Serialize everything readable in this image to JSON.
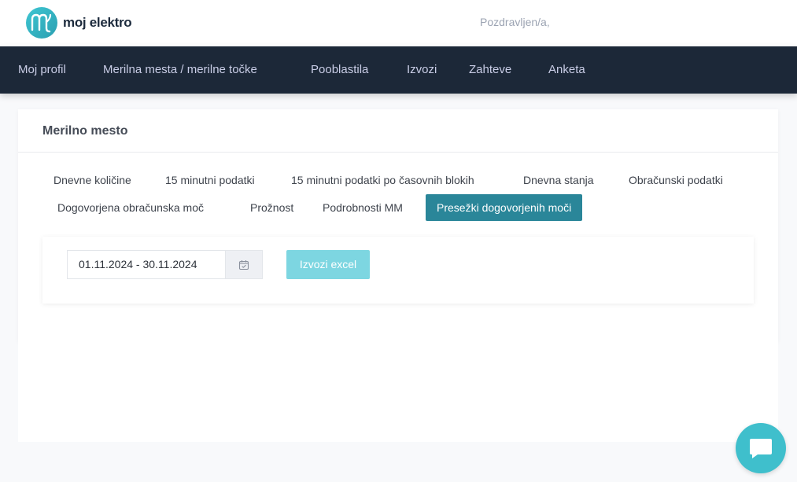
{
  "header": {
    "logo_text": "moj elektro",
    "greeting": "Pozdravljen/a,"
  },
  "nav": {
    "items": [
      {
        "label": "Moj profil"
      },
      {
        "label": "Merilna mesta / merilne točke"
      },
      {
        "label": "Pooblastila"
      },
      {
        "label": "Izvozi"
      },
      {
        "label": "Zahteve"
      },
      {
        "label": "Anketa"
      }
    ]
  },
  "card": {
    "title": "Merilno mesto",
    "tabs": [
      {
        "label": "Dnevne količine"
      },
      {
        "label": "15 minutni podatki"
      },
      {
        "label": "15 minutni podatki po časovnih blokih"
      },
      {
        "label": "Dnevna stanja"
      },
      {
        "label": "Obračunski podatki"
      },
      {
        "label": "Dogovorjena obračunska moč"
      },
      {
        "label": "Prožnost"
      },
      {
        "label": "Podrobnosti MM"
      },
      {
        "label": "Presežki dogovorjenih moči"
      }
    ],
    "active_tab": "Presežki dogovorjenih moči"
  },
  "filter": {
    "date_range": "01.11.2024 - 30.11.2024",
    "calendar_icon": "calendar-check-icon",
    "export_label": "Izvozi excel"
  },
  "chat": {
    "icon": "chat-bubble-icon"
  },
  "colors": {
    "nav_bg": "#1c2838",
    "accent": "#2a8699",
    "export_btn": "#7dd6e1",
    "chat_btn": "#3fbfcc"
  }
}
